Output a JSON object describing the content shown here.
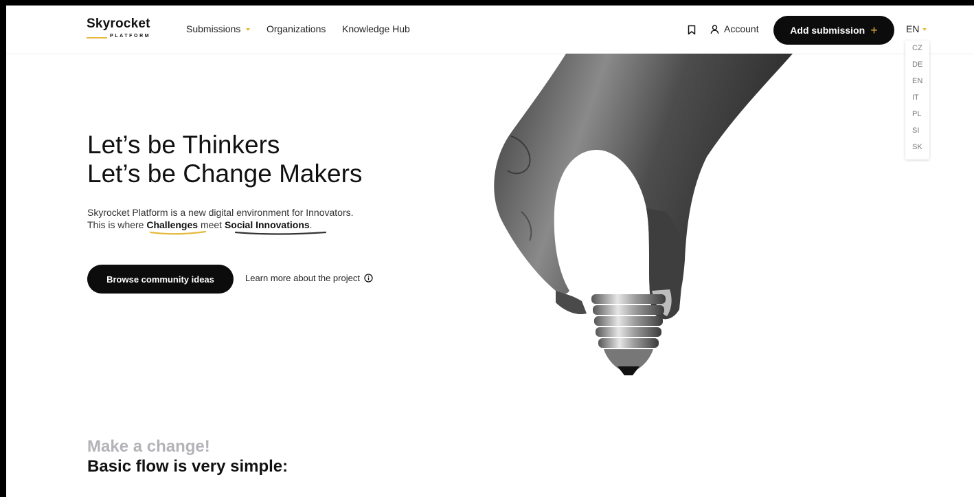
{
  "header": {
    "logo_main": "Skyrocket",
    "logo_sub": "PLATFORM",
    "nav": [
      {
        "label": "Submissions",
        "has_dropdown": true
      },
      {
        "label": "Organizations"
      },
      {
        "label": "Knowledge Hub"
      }
    ],
    "account_label": "Account",
    "add_submission_label": "Add submission",
    "add_submission_icon": "+",
    "language": {
      "current": "EN",
      "options": [
        "CZ",
        "DE",
        "EN",
        "IT",
        "PL",
        "SI",
        "SK"
      ]
    }
  },
  "hero": {
    "title_line1": "Let’s be Thinkers",
    "title_line2": "Let’s be Change Makers",
    "text_line1": "Skyrocket Platform is a new digital environment for Innovators.",
    "text_line2_prefix": "This is where ",
    "highlight1": "Challenges",
    "text_mid": " meet ",
    "highlight2": "Social Innovations",
    "text_end": ".",
    "browse_label": "Browse community ideas",
    "learn_more_label": "Learn more about the project"
  },
  "flow": {
    "subtitle": "Make a change!",
    "title": "Basic flow is very simple:"
  },
  "colors": {
    "accent": "#e5b93c",
    "button_bg": "#0c0c0c",
    "muted": "#b3b3b8"
  }
}
